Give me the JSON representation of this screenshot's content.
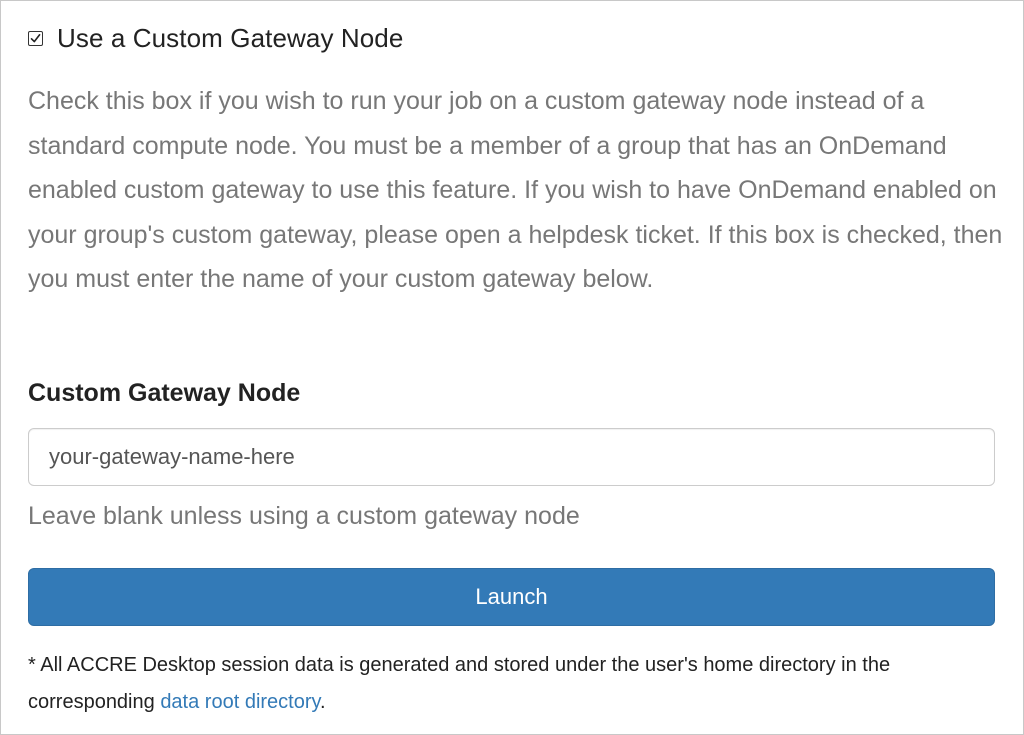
{
  "custom_gateway": {
    "checkbox_checked": true,
    "checkbox_label": "Use a Custom Gateway Node",
    "help_text": "Check this box if you wish to run your job on a custom gateway node instead of a standard compute node. You must be a member of a group that has an OnDemand enabled custom gateway to use this feature. If you wish to have OnDemand enabled on your group's custom gateway, please open a helpdesk ticket. If this box is checked, then you must enter the name of your custom gateway below."
  },
  "gateway_field": {
    "label": "Custom Gateway Node",
    "value": "your-gateway-name-here",
    "help": "Leave blank unless using a custom gateway node"
  },
  "launch_button": {
    "label": "Launch",
    "color": "#337ab7"
  },
  "footnote": {
    "prefix": "* All ACCRE Desktop session data is generated and stored under the user's home directory in the corresponding ",
    "link_text": "data root directory",
    "suffix": ".",
    "link_color": "#337ab7"
  },
  "icons": {
    "checkbox": "checkmark-icon"
  }
}
